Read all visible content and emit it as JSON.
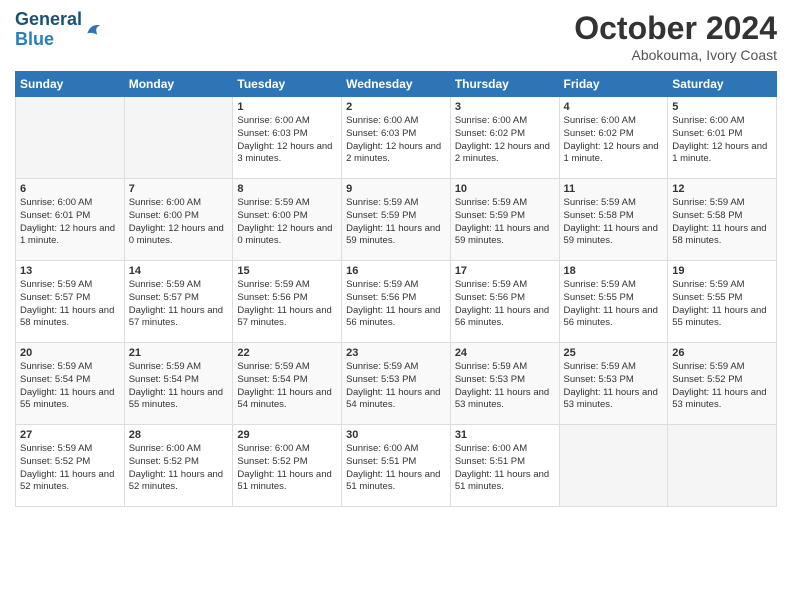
{
  "header": {
    "logo_line1": "General",
    "logo_line2": "Blue",
    "month": "October 2024",
    "location": "Abokouma, Ivory Coast"
  },
  "days_of_week": [
    "Sunday",
    "Monday",
    "Tuesday",
    "Wednesday",
    "Thursday",
    "Friday",
    "Saturday"
  ],
  "weeks": [
    [
      {
        "day": "",
        "content": ""
      },
      {
        "day": "",
        "content": ""
      },
      {
        "day": "1",
        "content": "Sunrise: 6:00 AM\nSunset: 6:03 PM\nDaylight: 12 hours and 3 minutes."
      },
      {
        "day": "2",
        "content": "Sunrise: 6:00 AM\nSunset: 6:03 PM\nDaylight: 12 hours and 2 minutes."
      },
      {
        "day": "3",
        "content": "Sunrise: 6:00 AM\nSunset: 6:02 PM\nDaylight: 12 hours and 2 minutes."
      },
      {
        "day": "4",
        "content": "Sunrise: 6:00 AM\nSunset: 6:02 PM\nDaylight: 12 hours and 1 minute."
      },
      {
        "day": "5",
        "content": "Sunrise: 6:00 AM\nSunset: 6:01 PM\nDaylight: 12 hours and 1 minute."
      }
    ],
    [
      {
        "day": "6",
        "content": "Sunrise: 6:00 AM\nSunset: 6:01 PM\nDaylight: 12 hours and 1 minute."
      },
      {
        "day": "7",
        "content": "Sunrise: 6:00 AM\nSunset: 6:00 PM\nDaylight: 12 hours and 0 minutes."
      },
      {
        "day": "8",
        "content": "Sunrise: 5:59 AM\nSunset: 6:00 PM\nDaylight: 12 hours and 0 minutes."
      },
      {
        "day": "9",
        "content": "Sunrise: 5:59 AM\nSunset: 5:59 PM\nDaylight: 11 hours and 59 minutes."
      },
      {
        "day": "10",
        "content": "Sunrise: 5:59 AM\nSunset: 5:59 PM\nDaylight: 11 hours and 59 minutes."
      },
      {
        "day": "11",
        "content": "Sunrise: 5:59 AM\nSunset: 5:58 PM\nDaylight: 11 hours and 59 minutes."
      },
      {
        "day": "12",
        "content": "Sunrise: 5:59 AM\nSunset: 5:58 PM\nDaylight: 11 hours and 58 minutes."
      }
    ],
    [
      {
        "day": "13",
        "content": "Sunrise: 5:59 AM\nSunset: 5:57 PM\nDaylight: 11 hours and 58 minutes."
      },
      {
        "day": "14",
        "content": "Sunrise: 5:59 AM\nSunset: 5:57 PM\nDaylight: 11 hours and 57 minutes."
      },
      {
        "day": "15",
        "content": "Sunrise: 5:59 AM\nSunset: 5:56 PM\nDaylight: 11 hours and 57 minutes."
      },
      {
        "day": "16",
        "content": "Sunrise: 5:59 AM\nSunset: 5:56 PM\nDaylight: 11 hours and 56 minutes."
      },
      {
        "day": "17",
        "content": "Sunrise: 5:59 AM\nSunset: 5:56 PM\nDaylight: 11 hours and 56 minutes."
      },
      {
        "day": "18",
        "content": "Sunrise: 5:59 AM\nSunset: 5:55 PM\nDaylight: 11 hours and 56 minutes."
      },
      {
        "day": "19",
        "content": "Sunrise: 5:59 AM\nSunset: 5:55 PM\nDaylight: 11 hours and 55 minutes."
      }
    ],
    [
      {
        "day": "20",
        "content": "Sunrise: 5:59 AM\nSunset: 5:54 PM\nDaylight: 11 hours and 55 minutes."
      },
      {
        "day": "21",
        "content": "Sunrise: 5:59 AM\nSunset: 5:54 PM\nDaylight: 11 hours and 55 minutes."
      },
      {
        "day": "22",
        "content": "Sunrise: 5:59 AM\nSunset: 5:54 PM\nDaylight: 11 hours and 54 minutes."
      },
      {
        "day": "23",
        "content": "Sunrise: 5:59 AM\nSunset: 5:53 PM\nDaylight: 11 hours and 54 minutes."
      },
      {
        "day": "24",
        "content": "Sunrise: 5:59 AM\nSunset: 5:53 PM\nDaylight: 11 hours and 53 minutes."
      },
      {
        "day": "25",
        "content": "Sunrise: 5:59 AM\nSunset: 5:53 PM\nDaylight: 11 hours and 53 minutes."
      },
      {
        "day": "26",
        "content": "Sunrise: 5:59 AM\nSunset: 5:52 PM\nDaylight: 11 hours and 53 minutes."
      }
    ],
    [
      {
        "day": "27",
        "content": "Sunrise: 5:59 AM\nSunset: 5:52 PM\nDaylight: 11 hours and 52 minutes."
      },
      {
        "day": "28",
        "content": "Sunrise: 6:00 AM\nSunset: 5:52 PM\nDaylight: 11 hours and 52 minutes."
      },
      {
        "day": "29",
        "content": "Sunrise: 6:00 AM\nSunset: 5:52 PM\nDaylight: 11 hours and 51 minutes."
      },
      {
        "day": "30",
        "content": "Sunrise: 6:00 AM\nSunset: 5:51 PM\nDaylight: 11 hours and 51 minutes."
      },
      {
        "day": "31",
        "content": "Sunrise: 6:00 AM\nSunset: 5:51 PM\nDaylight: 11 hours and 51 minutes."
      },
      {
        "day": "",
        "content": ""
      },
      {
        "day": "",
        "content": ""
      }
    ]
  ]
}
